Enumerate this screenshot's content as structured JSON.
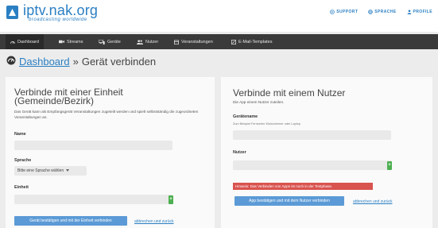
{
  "header": {
    "logo_text": "iptv.nak.org",
    "logo_tagline": "broadcasting worldwide",
    "topnav": [
      {
        "label": "SUPPORT",
        "icon": "help-circle-icon"
      },
      {
        "label": "SPRACHE",
        "icon": "globe-icon"
      },
      {
        "label": "PROFILE",
        "icon": "user-icon"
      }
    ]
  },
  "mainnav": [
    {
      "label": "Dashboard",
      "icon": "dashboard-icon",
      "active": true
    },
    {
      "label": "Streams",
      "icon": "video-camera-icon"
    },
    {
      "label": "Geräte",
      "icon": "devices-icon"
    },
    {
      "label": "Nutzer",
      "icon": "users-icon"
    },
    {
      "label": "Veranstaltungen",
      "icon": "calendar-icon"
    },
    {
      "label": "E-Mail-Templates",
      "icon": "email-template-icon"
    }
  ],
  "breadcrumb": {
    "root": "Dashboard",
    "separator": "»",
    "current": "Gerät verbinden"
  },
  "left_panel": {
    "title_line1": "Verbinde mit einer Einheit",
    "title_line2": "(Gemeinde/Bezirk)",
    "description": "Das Gerät kann als Empfangsgerät Veranstaltungen zugeteilt werden und spielt selbstständig die zugeordneten Veranstaltungen an.",
    "name_label": "Name",
    "name_value": "",
    "language_label": "Sprache",
    "language_value": "Bitte eine Sprache wählen",
    "unit_label": "Einheit",
    "unit_value": "",
    "unit_addon": "+",
    "submit_label": "Gerät bestätigen und mit der Einheit verbinden",
    "cancel_label": "abbrechen und zurück"
  },
  "right_panel": {
    "title": "Verbinde mit einem Nutzer",
    "description": "Die App einem Nutzer zuteilen.",
    "device_name_label": "Gerätename",
    "device_name_hint": "Zum Beispiel Fernseher Wohnzimmer oder Laptop",
    "device_name_value": "",
    "user_label": "Nutzer",
    "user_value": "",
    "user_addon": "+",
    "alert_text": "Hinweis: Das Verbinden von Apps ist noch in der Testphase.",
    "submit_label": "App bestätigen und mit dem Nutzer verbinden",
    "cancel_label": "abbrechen und zurück"
  },
  "colors": {
    "brand": "#2a7fc3",
    "nav_bg": "#3a3a3a",
    "button_primary": "#5b9ad6",
    "addon_green": "#4caf50",
    "alert_red": "#d9534f"
  }
}
